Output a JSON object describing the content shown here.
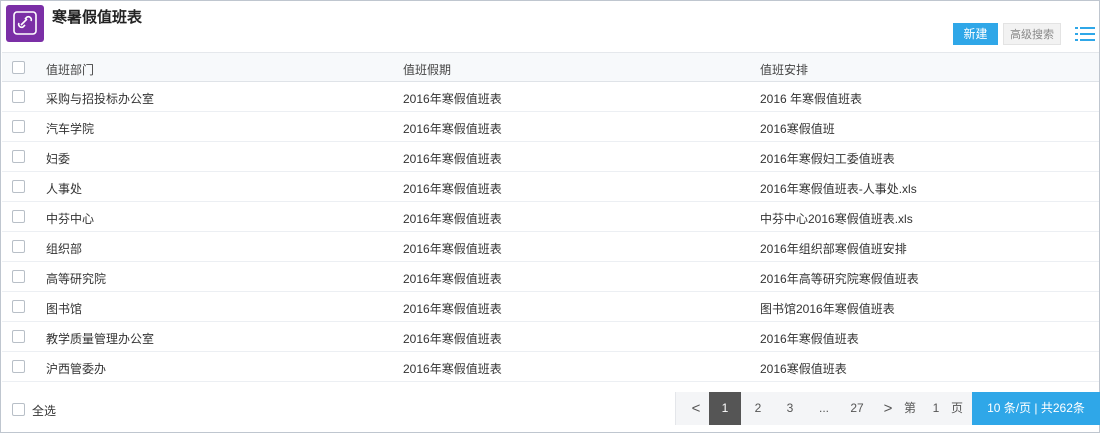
{
  "header": {
    "title": "寒暑假值班表",
    "new_button": "新建",
    "advanced_search_button": "高级搜索"
  },
  "icons": {
    "app_logo": "link-icon",
    "menu": "list-menu-icon"
  },
  "colors": {
    "accent": "#2fa7e8",
    "logo_bg": "#7b2fa6",
    "active_page": "#555555"
  },
  "table": {
    "columns": [
      "值班部门",
      "值班假期",
      "值班安排"
    ],
    "rows": [
      [
        "采购与招投标办公室",
        "2016年寒假值班表",
        "2016 年寒假值班表"
      ],
      [
        "汽车学院",
        "2016年寒假值班表",
        "2016寒假值班"
      ],
      [
        "妇委",
        "2016年寒假值班表",
        "2016年寒假妇工委值班表"
      ],
      [
        "人事处",
        "2016年寒假值班表",
        "2016年寒假值班表-人事处.xls"
      ],
      [
        "中芬中心",
        "2016年寒假值班表",
        "中芬中心2016寒假值班表.xls"
      ],
      [
        "组织部",
        "2016年寒假值班表",
        "2016年组织部寒假值班安排"
      ],
      [
        "高等研究院",
        "2016年寒假值班表",
        "2016年高等研究院寒假值班表"
      ],
      [
        "图书馆",
        "2016年寒假值班表",
        "图书馆2016年寒假值班表"
      ],
      [
        "教学质量管理办公室",
        "2016年寒假值班表",
        "2016年寒假值班表"
      ],
      [
        "沪西管委办",
        "2016年寒假值班表",
        "2016寒假值班表"
      ]
    ]
  },
  "footer": {
    "select_all": "全选",
    "pager": {
      "prev": "<",
      "next": ">",
      "pages": [
        "1",
        "2",
        "3",
        "...",
        "27"
      ],
      "current": "1",
      "goto_prefix": "第",
      "goto_value": "1",
      "goto_suffix": "页",
      "page_size_text": "10   条/页 | 共262条"
    }
  }
}
